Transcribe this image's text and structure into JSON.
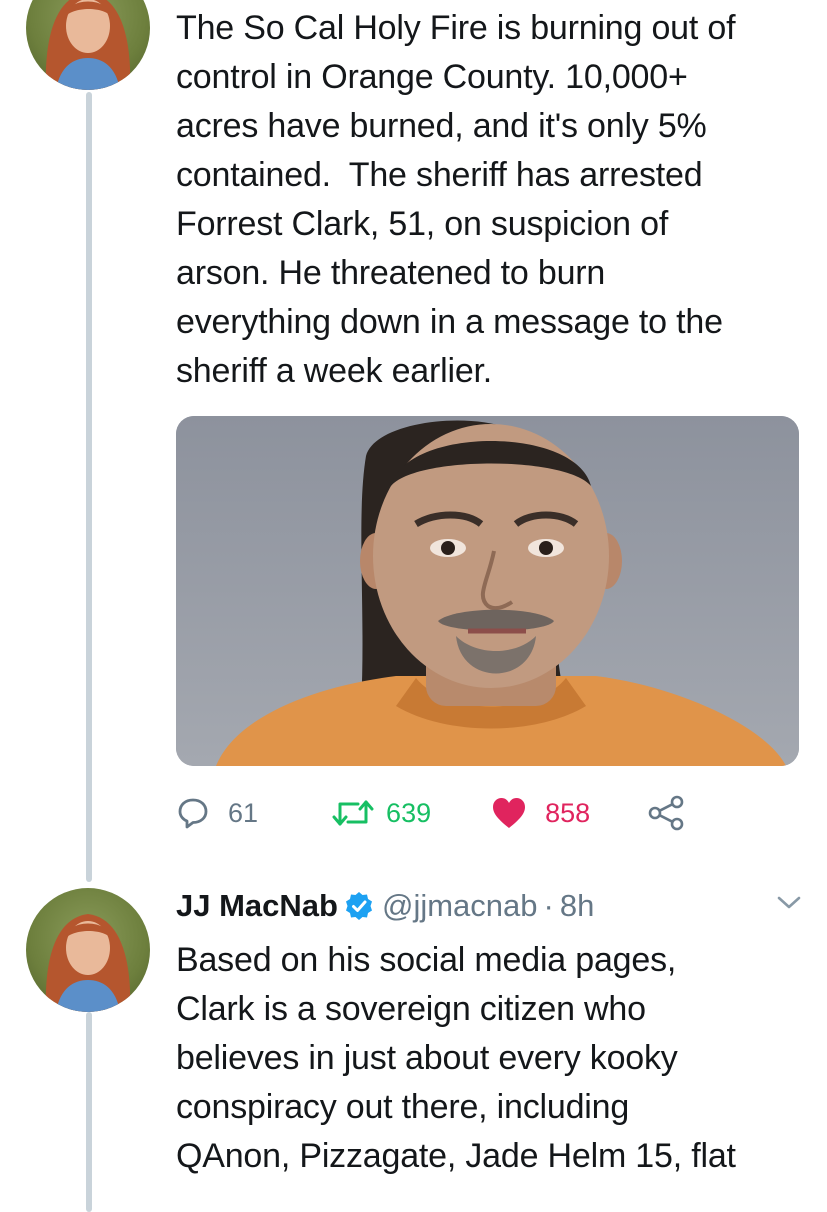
{
  "tweet1": {
    "text": "The So Cal Holy Fire is burning out of\ncontrol in Orange County. 10,000+\nacres have burned, and it's only 5%\ncontained.  The sheriff has arrested\nForrest Clark, 51, on suspicion of\narson. He threatened to burn\neverything down in a message to the\nsheriff a week earlier.",
    "actions": {
      "replies": "61",
      "retweets": "639",
      "likes": "858"
    }
  },
  "tweet2": {
    "author": "JJ MacNab",
    "handle": "@jjmacnab",
    "separator": "·",
    "time": "8h",
    "text": "Based on his social media pages,\nClark is a sovereign citizen who\nbelieves in just about every kooky\nconspiracy out there, including\nQAnon, Pizzagate, Jade Helm 15, flat"
  },
  "colors": {
    "retweet": "#17bf63",
    "like": "#e0245e",
    "verified": "#1da1f2",
    "muted": "#657786",
    "thread_line": "#c9d3da"
  },
  "icons": [
    "reply-icon",
    "retweet-icon",
    "heart-icon",
    "share-icon",
    "verified-badge-icon",
    "chevron-down-icon"
  ]
}
